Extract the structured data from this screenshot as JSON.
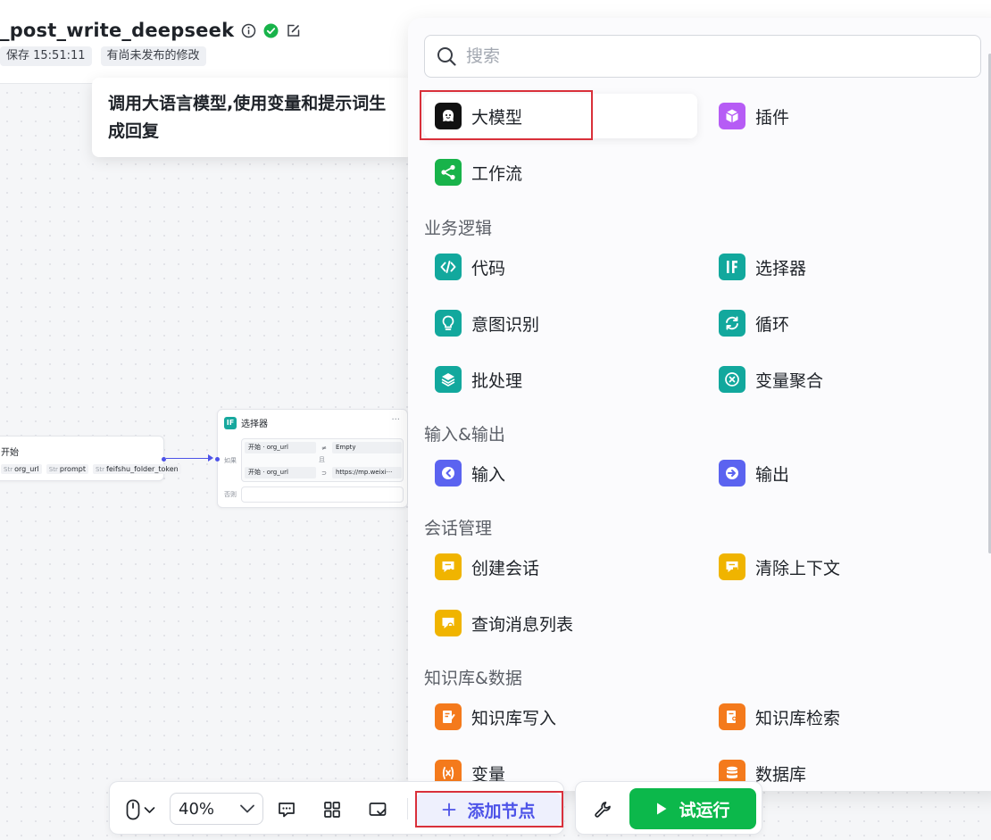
{
  "header": {
    "title": "_post_write_deepseek",
    "save_status": "保存 15:51:11",
    "unpublished_tag": "有尚未发布的修改"
  },
  "tooltip": {
    "text": "调用大语言模型,使用变量和提示词生成回复"
  },
  "canvas": {
    "start_node": {
      "title": "开始",
      "vars": [
        {
          "type": "Str",
          "name": "org_url"
        },
        {
          "type": "Str",
          "name": "prompt"
        },
        {
          "type": "Str",
          "name": "feifshu_folder_token"
        }
      ]
    },
    "selector_node": {
      "badge": "IF",
      "title": "选择器",
      "more": "···",
      "if_label": "如果",
      "and_label": "且",
      "else_label": "否则",
      "conditions": [
        {
          "left": "开始",
          "var": "org_url",
          "op": "≠",
          "right": "Empty"
        },
        {
          "left": "开始",
          "var": "org_url",
          "op": "⊃",
          "right": "https://mp.weixi···"
        }
      ]
    }
  },
  "panel": {
    "search_placeholder": "搜索",
    "top_items": [
      {
        "label": "大模型",
        "icon": "llm-icon",
        "color": "#111111"
      },
      {
        "label": "插件",
        "icon": "plugin-cube-icon",
        "color": "#b65cf5"
      },
      {
        "label": "工作流",
        "icon": "workflow-icon",
        "color": "#18b34a"
      }
    ],
    "sections": [
      {
        "title": "业务逻辑",
        "items": [
          {
            "label": "代码",
            "icon": "code-icon",
            "color": "#12a89d"
          },
          {
            "label": "选择器",
            "icon": "if-icon",
            "color": "#12a89d"
          },
          {
            "label": "意图识别",
            "icon": "bulb-icon",
            "color": "#12a89d"
          },
          {
            "label": "循环",
            "icon": "loop-icon",
            "color": "#12a89d"
          },
          {
            "label": "批处理",
            "icon": "layers-icon",
            "color": "#12a89d"
          },
          {
            "label": "变量聚合",
            "icon": "aggregate-icon",
            "color": "#12a89d"
          }
        ]
      },
      {
        "title": "输入&输出",
        "items": [
          {
            "label": "输入",
            "icon": "input-icon",
            "color": "#5b63f0"
          },
          {
            "label": "输出",
            "icon": "output-icon",
            "color": "#5b63f0"
          }
        ]
      },
      {
        "title": "会话管理",
        "items": [
          {
            "label": "创建会话",
            "icon": "chat-add-icon",
            "color": "#f0b400"
          },
          {
            "label": "清除上下文",
            "icon": "chat-clear-icon",
            "color": "#f0b400"
          },
          {
            "label": "查询消息列表",
            "icon": "chat-search-icon",
            "color": "#f0b400"
          }
        ]
      },
      {
        "title": "知识库&数据",
        "items": [
          {
            "label": "知识库写入",
            "icon": "kb-write-icon",
            "color": "#f47a1c"
          },
          {
            "label": "知识库检索",
            "icon": "kb-search-icon",
            "color": "#f47a1c"
          },
          {
            "label": "变量",
            "icon": "variable-icon",
            "color": "#f47a1c"
          },
          {
            "label": "数据库",
            "icon": "database-icon",
            "color": "#f47a1c"
          }
        ]
      }
    ]
  },
  "toolbar": {
    "zoom": "40%",
    "add_node": "添加节点",
    "run": "试运行"
  }
}
